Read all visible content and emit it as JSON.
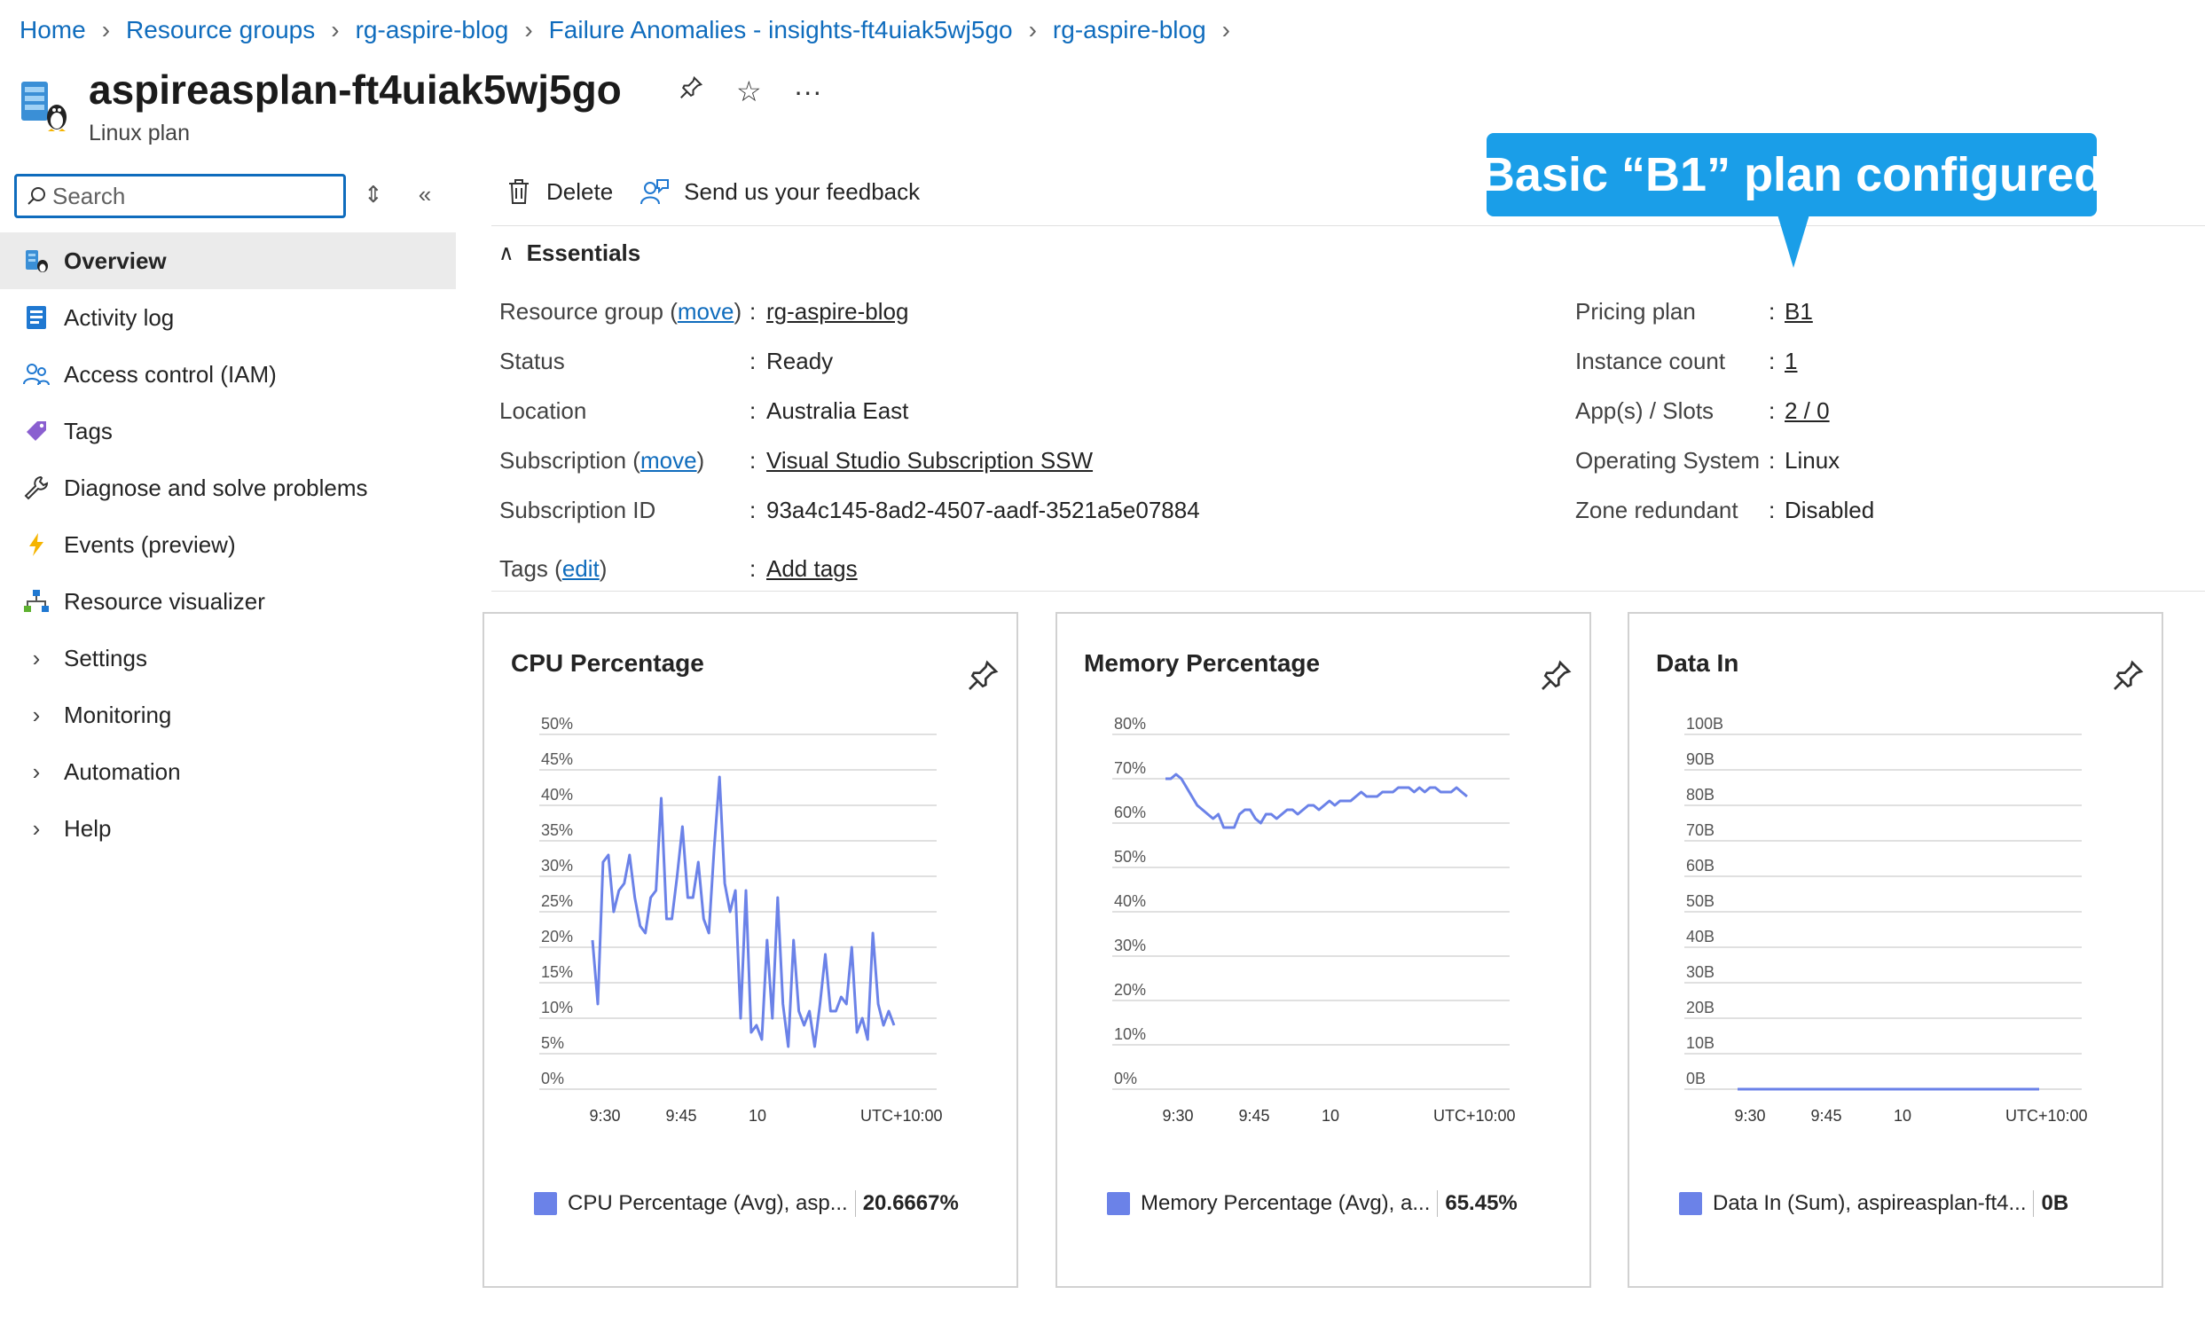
{
  "breadcrumb": [
    "Home",
    "Resource groups",
    "rg-aspire-blog",
    "Failure Anomalies - insights-ft4uiak5wj5go",
    "rg-aspire-blog"
  ],
  "title": "aspireasplan-ft4uiak5wj5go",
  "subtitle": "Linux plan",
  "search": {
    "placeholder": "Search"
  },
  "nav": {
    "items": [
      {
        "label": "Overview",
        "icon": "overview-icon",
        "active": true
      },
      {
        "label": "Activity log",
        "icon": "activity-log-icon"
      },
      {
        "label": "Access control (IAM)",
        "icon": "people-icon"
      },
      {
        "label": "Tags",
        "icon": "tag-icon"
      },
      {
        "label": "Diagnose and solve problems",
        "icon": "wrench-icon"
      },
      {
        "label": "Events (preview)",
        "icon": "lightning-icon"
      },
      {
        "label": "Resource visualizer",
        "icon": "hierarchy-icon"
      }
    ],
    "groups": [
      "Settings",
      "Monitoring",
      "Automation",
      "Help"
    ]
  },
  "toolbar": {
    "delete": "Delete",
    "feedback": "Send us your feedback"
  },
  "essentials": {
    "heading": "Essentials",
    "left": [
      {
        "label": "Resource group",
        "extra": "move",
        "value": "rg-aspire-blog",
        "link": true
      },
      {
        "label": "Status",
        "value": "Ready",
        "link": false
      },
      {
        "label": "Location",
        "value": "Australia East",
        "link": false
      },
      {
        "label": "Subscription",
        "extra": "move",
        "value": "Visual Studio Subscription SSW",
        "link": true
      },
      {
        "label": "Subscription ID",
        "value": "93a4c145-8ad2-4507-aadf-3521a5e07884",
        "link": false
      },
      {
        "label": "Tags",
        "extra": "edit",
        "value": "Add tags",
        "link": true
      }
    ],
    "right": [
      {
        "label": "Pricing plan",
        "value": "B1",
        "link": true
      },
      {
        "label": "Instance count",
        "value": "1",
        "link": true
      },
      {
        "label": "App(s) / Slots",
        "value": "2 / 0",
        "link": true
      },
      {
        "label": "Operating System",
        "value": "Linux",
        "link": false
      },
      {
        "label": "Zone redundant",
        "value": "Disabled",
        "link": false
      }
    ]
  },
  "callout": "Basic “B1” plan configured",
  "colors": {
    "accent": "#0f6cbd",
    "series": "#6b82e8",
    "callout": "#1a9ee8"
  },
  "chart_data": [
    {
      "type": "line",
      "title": "CPU Percentage",
      "yticks": [
        "50%",
        "45%",
        "40%",
        "35%",
        "30%",
        "25%",
        "20%",
        "15%",
        "10%",
        "5%",
        "0%"
      ],
      "ylim": [
        0,
        50
      ],
      "xticks": [
        "9:30",
        "9:45",
        "10"
      ],
      "timezone": "UTC+10:00",
      "values": [
        21,
        12,
        32,
        33,
        25,
        28,
        29,
        33,
        27,
        23,
        22,
        27,
        28,
        41,
        24,
        24,
        30,
        37,
        27,
        27,
        32,
        24,
        22,
        34,
        44,
        29,
        25,
        28,
        10,
        28,
        8,
        9,
        7,
        21,
        10,
        27,
        12,
        6,
        21,
        11,
        9,
        11,
        6,
        12,
        19,
        11,
        11,
        13,
        12,
        20,
        8,
        10,
        7,
        22,
        12,
        9,
        11,
        9
      ],
      "legend": "CPU Percentage (Avg), asp...",
      "summary": "20.6667%"
    },
    {
      "type": "line",
      "title": "Memory Percentage",
      "yticks": [
        "80%",
        "70%",
        "60%",
        "50%",
        "40%",
        "30%",
        "20%",
        "10%",
        "0%"
      ],
      "ylim": [
        0,
        80
      ],
      "xticks": [
        "9:30",
        "9:45",
        "10"
      ],
      "timezone": "UTC+10:00",
      "values": [
        70,
        70,
        71,
        70,
        68,
        66,
        64,
        63,
        62,
        61,
        62,
        59,
        59,
        59,
        62,
        63,
        63,
        61,
        60,
        62,
        62,
        61,
        62,
        63,
        63,
        62,
        63,
        64,
        64,
        63,
        64,
        65,
        64,
        65,
        65,
        65,
        66,
        67,
        66,
        66,
        66,
        67,
        67,
        67,
        68,
        68,
        68,
        67,
        68,
        67,
        68,
        68,
        67,
        67,
        67,
        68,
        67,
        66
      ],
      "legend": "Memory Percentage (Avg), a...",
      "summary": "65.45%"
    },
    {
      "type": "line",
      "title": "Data In",
      "yticks": [
        "100B",
        "90B",
        "80B",
        "70B",
        "60B",
        "50B",
        "40B",
        "30B",
        "20B",
        "10B",
        "0B"
      ],
      "ylim": [
        0,
        100
      ],
      "xticks": [
        "9:30",
        "9:45",
        "10"
      ],
      "timezone": "UTC+10:00",
      "values": [
        0,
        0,
        0,
        0,
        0,
        0,
        0,
        0,
        0,
        0,
        0,
        0,
        0,
        0,
        0,
        0,
        0,
        0,
        0,
        0,
        0,
        0,
        0,
        0,
        0,
        0,
        0,
        0,
        0,
        0,
        0,
        0,
        0,
        0,
        0,
        0,
        0,
        0,
        0,
        0,
        0,
        0,
        0,
        0,
        0,
        0,
        0,
        0,
        0,
        0,
        0,
        0,
        0,
        0,
        0,
        0,
        0,
        0
      ],
      "legend": "Data In (Sum), aspireasplan-ft4...",
      "summary": "0B"
    }
  ]
}
